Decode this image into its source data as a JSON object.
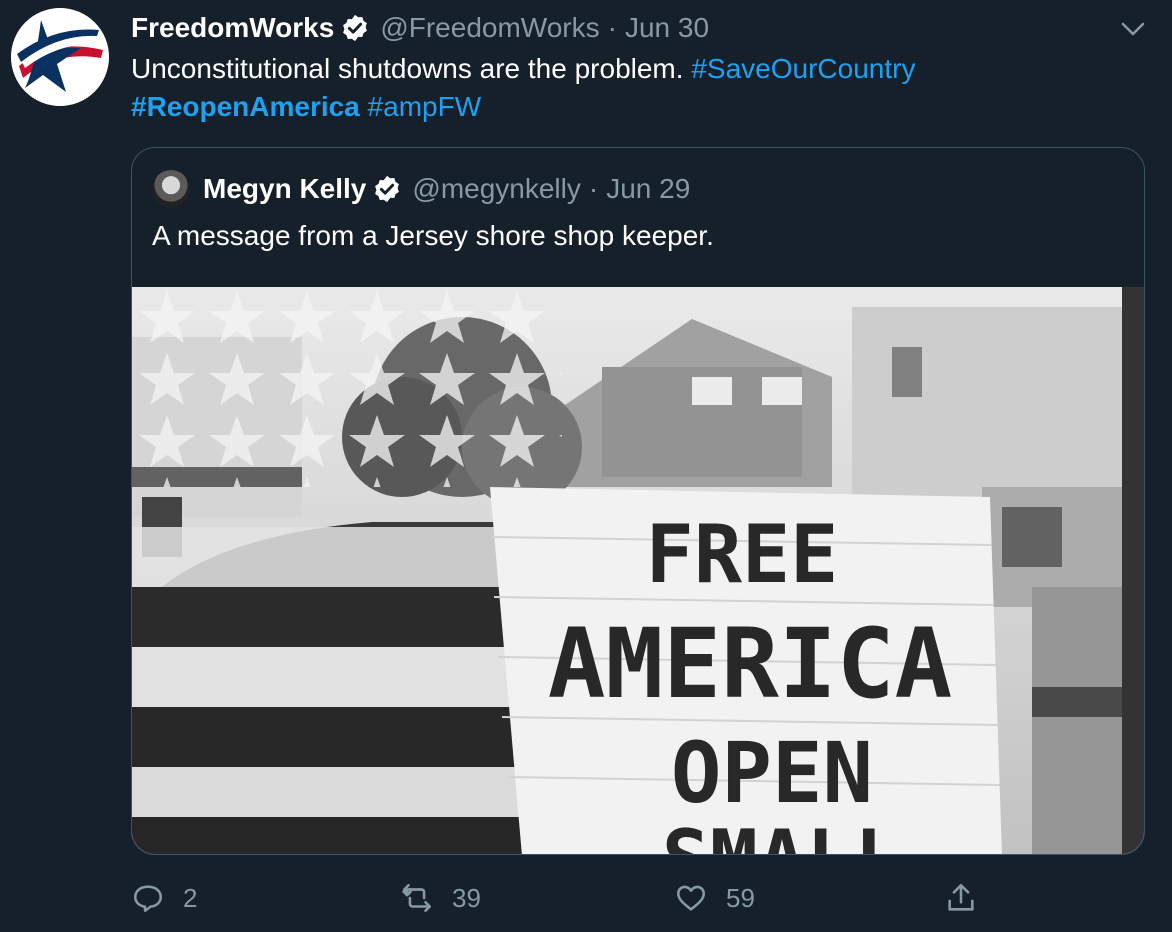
{
  "tweet": {
    "author": {
      "name": "FreedomWorks",
      "handle": "@FreedomWorks",
      "date": "Jun 30",
      "separator": "·"
    },
    "text": {
      "main": "Unconstitutional shutdowns are the problem.",
      "hashtags": [
        "#SaveOurCountry",
        "#ReopenAmerica",
        "#ampFW"
      ]
    },
    "quoted": {
      "name": "Megyn Kelly",
      "handle": "@megynkelly",
      "date": "Jun 29",
      "separator": "·",
      "text": "A message from a Jersey shore shop keeper.",
      "image_sign": {
        "lines": [
          "FREE",
          "AMERICA",
          "OPEN",
          "SMALL"
        ]
      }
    },
    "actions": {
      "replies": "2",
      "retweets": "39",
      "likes": "59"
    }
  },
  "colors": {
    "background": "#15202b",
    "link": "#1da1f2",
    "secondary_text": "#8899a6",
    "border": "#3d5466",
    "verified": "#ffffff"
  },
  "icons": [
    "freedomworks-logo",
    "verified-badge-icon",
    "chevron-down-icon",
    "reply-icon",
    "retweet-icon",
    "like-icon",
    "share-icon"
  ]
}
